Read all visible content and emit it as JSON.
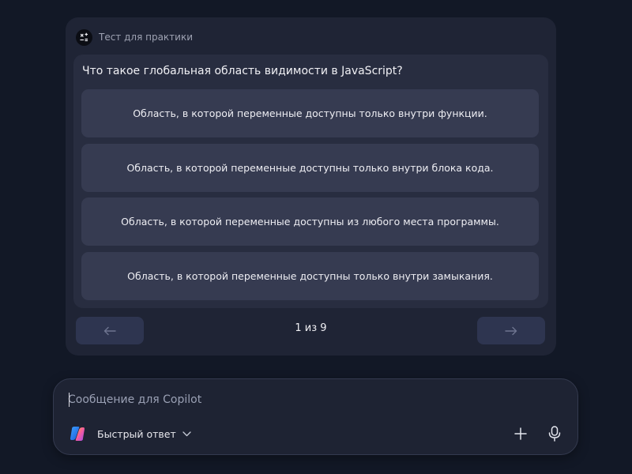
{
  "quiz": {
    "header_title": "Тест для практики",
    "question": "Что такое глобальная область видимости в JavaScript?",
    "options": [
      {
        "label": "Область, в которой переменные доступны только внутри функции."
      },
      {
        "label": "Область, в которой переменные доступны только внутри блока кода."
      },
      {
        "label": "Область, в которой переменные доступны из любого места программы."
      },
      {
        "label": "Область, в которой переменные доступны только внутри замыкания."
      }
    ],
    "pagination": {
      "label": "1 из 9",
      "prev_icon": "arrow-left-icon",
      "next_icon": "arrow-right-icon"
    }
  },
  "composer": {
    "placeholder": "Сообщение для Copilot",
    "value": "",
    "mode_label": "Быстрый ответ",
    "icons": [
      "copilot-logo-icon",
      "chevron-down-icon",
      "plus-icon",
      "microphone-icon"
    ]
  },
  "colors": {
    "background": "#121826",
    "card": "#1f2435",
    "panel": "#282d40",
    "option": "#363b51",
    "nav_button": "#2e3550"
  }
}
